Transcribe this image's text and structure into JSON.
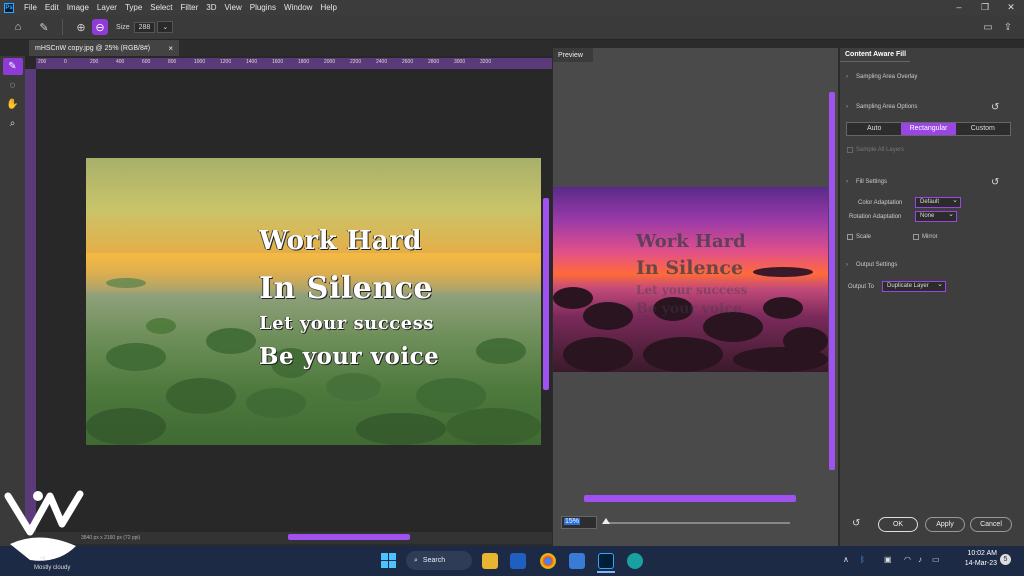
{
  "menu": [
    "File",
    "Edit",
    "Image",
    "Layer",
    "Type",
    "Select",
    "Filter",
    "3D",
    "View",
    "Plugins",
    "Window",
    "Help"
  ],
  "app_logo": "Ps",
  "options": {
    "size_label": "Size",
    "size_value": "288"
  },
  "document": {
    "tab_title": "mHSCnW copy.jpg @ 25% (RGB/8#)",
    "close": "×",
    "status": "3840 px x 2160 px (72 ppi)"
  },
  "ruler_ticks": [
    "200",
    "0",
    "200",
    "400",
    "600",
    "800",
    "1000",
    "1200",
    "1400",
    "1600",
    "1800",
    "2000",
    "2200",
    "2400",
    "2600",
    "2800",
    "3000",
    "3200"
  ],
  "quote": {
    "line1": "Work Hard",
    "line2": "In Silence",
    "line3": "Let your success",
    "line4": "Be your voice"
  },
  "preview": {
    "tab": "Preview",
    "zoom": "15%",
    "quote1": "Work Hard",
    "quote2": "In Silence",
    "quote3": "Let your success",
    "quote4": "Be your voice"
  },
  "caf": {
    "title": "Content Aware Fill",
    "sampling_overlay": "Sampling Area Overlay",
    "sampling_options": "Sampling Area Options",
    "seg": [
      "Auto",
      "Rectangular",
      "Custom"
    ],
    "seg_selected": "Rectangular",
    "sample_all": "Sample All Layers",
    "fill_settings": "Fill Settings",
    "color_adaptation_label": "Color Adaptation",
    "color_adaptation_value": "Default",
    "rotation_adaptation_label": "Rotation Adaptation",
    "rotation_adaptation_value": "None",
    "scale": "Scale",
    "mirror": "Mirror",
    "output_settings": "Output Settings",
    "output_to_label": "Output To",
    "output_to_value": "Duplicate Layer",
    "ok": "OK",
    "apply": "Apply",
    "cancel": "Cancel"
  },
  "taskbar": {
    "search": "Search",
    "time": "10:02 AM",
    "date": "14-Mar-23",
    "weather_temp": "…°F",
    "weather": "Mostly cloudy",
    "badge": "5"
  },
  "accent": "#9a45e6"
}
